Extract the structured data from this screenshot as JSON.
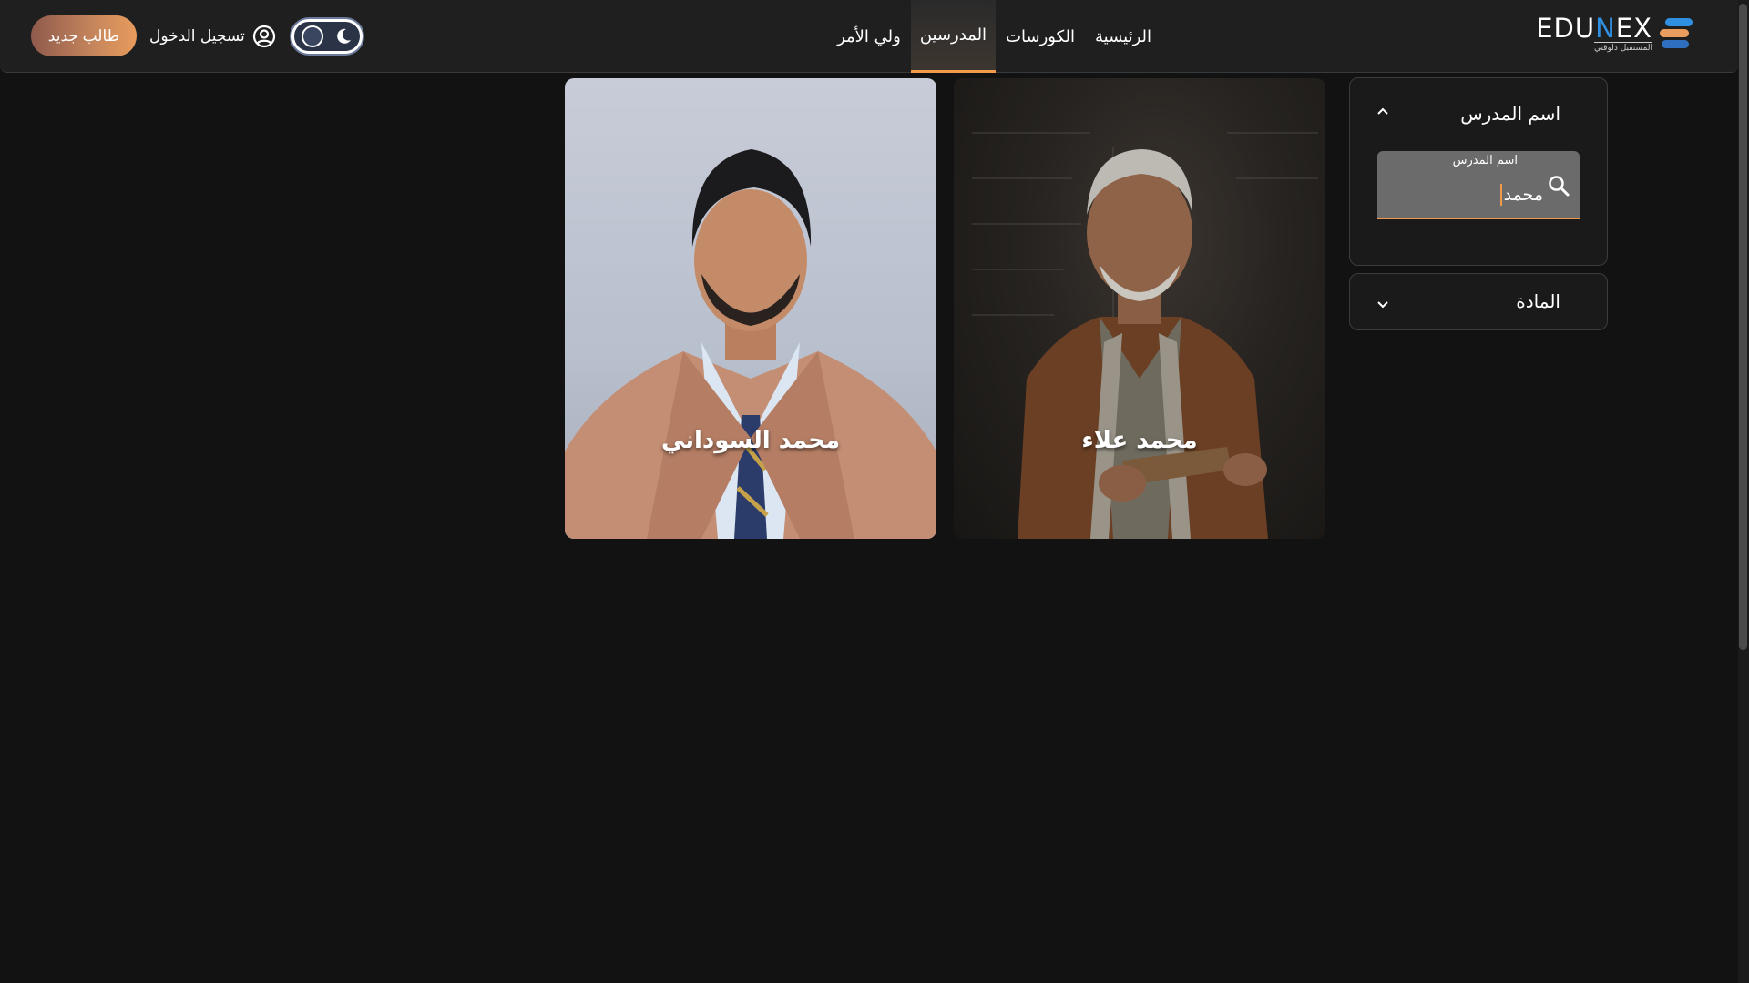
{
  "logo": {
    "prefix": "EDU",
    "accent": "N",
    "suffix": "EX",
    "tagline": "المستقبل دلوقتي"
  },
  "nav": {
    "items": [
      {
        "label": "الرئيسية",
        "active": false
      },
      {
        "label": "الكورسات",
        "active": false
      },
      {
        "label": "المدرسين",
        "active": true
      },
      {
        "label": "ولي الأمر",
        "active": false
      }
    ]
  },
  "header": {
    "login_label": "تسجيل الدخول",
    "new_student_label": "طالب جديد",
    "theme": "dark"
  },
  "filters": {
    "teacher_name": {
      "title": "اسم المدرس",
      "expanded": true,
      "input_label": "اسم المدرس",
      "input_value": "محمد"
    },
    "subject": {
      "title": "المادة",
      "expanded": false
    }
  },
  "teachers": [
    {
      "name": "محمد علاء"
    },
    {
      "name": "محمد السوداني"
    }
  ],
  "colors": {
    "accent": "#f09a4a",
    "background": "#121212",
    "header": "#1f1f1f",
    "logo_blue": "#2f8fe0"
  }
}
